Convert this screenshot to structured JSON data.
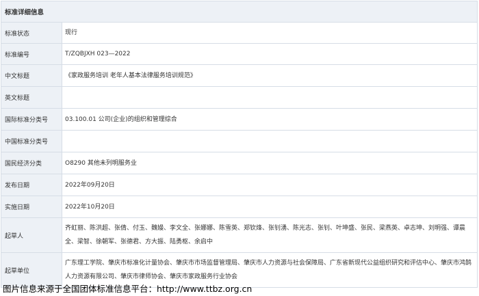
{
  "table": {
    "header": "标准详细信息",
    "rows": [
      {
        "label": "标准状态",
        "value": "现行"
      },
      {
        "label": "标准编号",
        "value": "T/ZQBJXH 023—2022"
      },
      {
        "label": "中文标题",
        "value": "《家政服务培训 老年人基本法律服务培训规范》"
      },
      {
        "label": "英文标题",
        "value": ""
      },
      {
        "label": "国际标准分类号",
        "value": "03.100.01 公司(企业)的组织和管理综合"
      },
      {
        "label": "中国标准分类号",
        "value": ""
      },
      {
        "label": "国民经济分类",
        "value": "O8290 其他未列明服务业"
      },
      {
        "label": "发布日期",
        "value": "2022年09月20日"
      },
      {
        "label": "实施日期",
        "value": "2022年10月20日"
      },
      {
        "label": "起草人",
        "value": "齐虹丽、陈洪超、张倩、付玉、魏嫚、李文全、张娜娜、陈雪英、郑钦烽、张钊湧、陈光志、张钊、叶坤盛、张民、梁燕英、卓志坤、刘明强、谭晨全、梁智、徐朝军、张德君、方大振、陆勇枢、余启中"
      },
      {
        "label": "起草单位",
        "value": "广东理工学院、肇庆市标准化计量协会、肇庆市市场监督管理局、肇庆市人力资源与社会保障局、广东省新现代公益组织研究和评估中心、肇庆市鸿鹄人力资源有限公司、肇庆市律师协会、肇庆市家政服务行业协会"
      }
    ]
  },
  "footer": "图片信息来源于全国团体标准信息平台：http://www.ttbz.org.cn"
}
